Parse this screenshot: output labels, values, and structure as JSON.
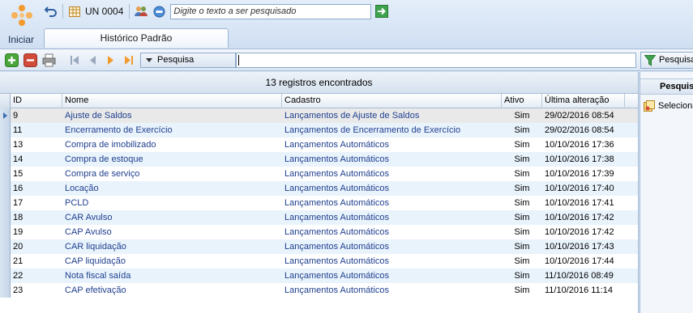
{
  "app": {
    "start_label": "Iniciar",
    "unit_label": "UN 0004",
    "search_placeholder": "Digite o texto a ser pesquisado",
    "active_tab": "Histórico Padrão"
  },
  "toolbar": {
    "filter_field": "Pesquisa",
    "search_button": "Pesquisa"
  },
  "grid": {
    "records_found": "13 registros encontrados",
    "columns": [
      "ID",
      "Nome",
      "Cadastro",
      "Ativo",
      "Última alteração"
    ],
    "rows": [
      {
        "id": "9",
        "nome": "Ajuste de Saldos",
        "cadastro": "Lançamentos de Ajuste de Saldos",
        "ativo": "Sim",
        "alteracao": "29/02/2016 08:54"
      },
      {
        "id": "11",
        "nome": "Encerramento de Exercício",
        "cadastro": "Lançamentos de Encerramento de Exercício",
        "ativo": "Sim",
        "alteracao": "29/02/2016 08:54"
      },
      {
        "id": "13",
        "nome": "Compra de imobilizado",
        "cadastro": "Lançamentos Automáticos",
        "ativo": "Sim",
        "alteracao": "10/10/2016 17:36"
      },
      {
        "id": "14",
        "nome": "Compra de estoque",
        "cadastro": "Lançamentos Automáticos",
        "ativo": "Sim",
        "alteracao": "10/10/2016 17:38"
      },
      {
        "id": "15",
        "nome": "Compra de serviço",
        "cadastro": "Lançamentos Automáticos",
        "ativo": "Sim",
        "alteracao": "10/10/2016 17:39"
      },
      {
        "id": "16",
        "nome": "Locação",
        "cadastro": "Lançamentos Automáticos",
        "ativo": "Sim",
        "alteracao": "10/10/2016 17:40"
      },
      {
        "id": "17",
        "nome": "PCLD",
        "cadastro": "Lançamentos Automáticos",
        "ativo": "Sim",
        "alteracao": "10/10/2016 17:41"
      },
      {
        "id": "18",
        "nome": "CAR Avulso",
        "cadastro": "Lançamentos Automáticos",
        "ativo": "Sim",
        "alteracao": "10/10/2016 17:42"
      },
      {
        "id": "19",
        "nome": "CAP Avulso",
        "cadastro": "Lançamentos Automáticos",
        "ativo": "Sim",
        "alteracao": "10/10/2016 17:42"
      },
      {
        "id": "20",
        "nome": "CAR liquidação",
        "cadastro": "Lançamentos Automáticos",
        "ativo": "Sim",
        "alteracao": "10/10/2016 17:43"
      },
      {
        "id": "21",
        "nome": "CAP liquidação",
        "cadastro": "Lançamentos Automáticos",
        "ativo": "Sim",
        "alteracao": "10/10/2016 17:44"
      },
      {
        "id": "22",
        "nome": "Nota fiscal saída",
        "cadastro": "Lançamentos Automáticos",
        "ativo": "Sim",
        "alteracao": "11/10/2016 08:49"
      },
      {
        "id": "23",
        "nome": "CAP efetivação",
        "cadastro": "Lançamentos Automáticos",
        "ativo": "Sim",
        "alteracao": "11/10/2016 11:14"
      }
    ]
  },
  "side_panel": {
    "title": "Pesquisa",
    "item": "Selecionar"
  },
  "icons": {
    "start": "orange-dots-logo-icon",
    "undo": "undo-arrow-icon",
    "unit": "calendar-grid-icon",
    "users": "users-icon",
    "refresh": "refresh-icon",
    "go": "green-go-arrow-icon",
    "add": "plus-icon",
    "remove": "minus-icon",
    "print": "printer-icon",
    "first": "first-page-icon",
    "prev": "previous-icon",
    "next": "next-icon",
    "last": "last-page-icon",
    "funnel": "funnel-icon",
    "select": "select-icon"
  },
  "colors": {
    "row_alt": "#e9f3fc",
    "row_selected": "#e9e9e9",
    "link_text": "#1f3f8f",
    "accent_orange": "#f29a2e",
    "add_green": "#4aa63a",
    "remove_red": "#d24b3a"
  }
}
